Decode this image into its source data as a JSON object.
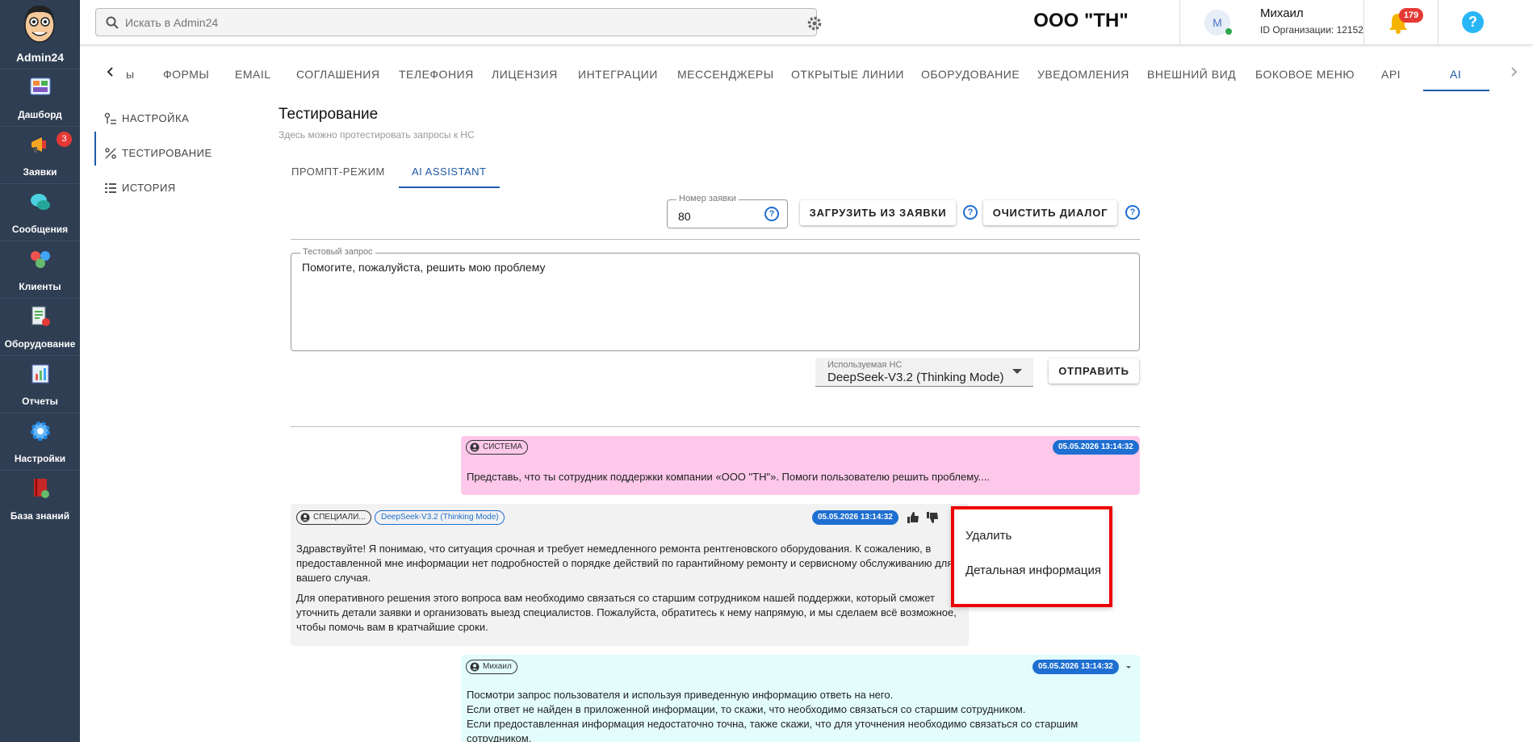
{
  "app": {
    "name": "Admin24"
  },
  "sidebar": {
    "items": [
      {
        "label": "Дашборд",
        "icon": "dashboard-icon"
      },
      {
        "label": "Заявки",
        "icon": "megaphone-icon",
        "badge": "3"
      },
      {
        "label": "Сообщения",
        "icon": "chat-icon"
      },
      {
        "label": "Клиенты",
        "icon": "clients-icon"
      },
      {
        "label": "Оборудование",
        "icon": "equipment-icon"
      },
      {
        "label": "Отчеты",
        "icon": "reports-icon"
      },
      {
        "label": "Настройки",
        "icon": "gear-icon"
      },
      {
        "label": "База знаний",
        "icon": "knowledge-base-icon"
      }
    ]
  },
  "header": {
    "search_placeholder": "Искать в Admin24",
    "org_title": "ООО \"ТН\"",
    "user": {
      "initial": "М",
      "name": "Михаил",
      "org_id": "ID Организации: 12152"
    },
    "notifications_count": "179",
    "help_label": "?"
  },
  "tabs": [
    "ы",
    "ФОРМЫ",
    "EMAIL",
    "СОГЛАШЕНИЯ",
    "ТЕЛЕФОНИЯ",
    "ЛИЦЕНЗИЯ",
    "ИНТЕГРАЦИИ",
    "МЕССЕНДЖЕРЫ",
    "ОТКРЫТЫЕ ЛИНИИ",
    "ОБОРУДОВАНИЕ",
    "УВЕДОМЛЕНИЯ",
    "ВНЕШНИЙ ВИД",
    "БОКОВОЕ МЕНЮ",
    "API",
    "AI"
  ],
  "submenu": [
    "НАСТРОЙКА",
    "ТЕСТИРОВАНИЕ",
    "ИСТОРИЯ"
  ],
  "page": {
    "title": "Тестирование",
    "subtitle": "Здесь можно протестировать запросы к НС",
    "inner_tabs": [
      "ПРОМПТ-РЕЖИМ",
      "AI ASSISTANT"
    ],
    "ticket_field": {
      "label": "Номер заявки",
      "value": "80"
    },
    "load_button": "ЗАГРУЗИТЬ ИЗ ЗАЯВКИ",
    "clear_button": "ОЧИСТИТЬ ДИАЛОГ",
    "query_field": {
      "label": "Тестовый запрос",
      "value": "Помогите, пожалуйста, решить мою проблему"
    },
    "model_select": {
      "label": "Используемая НС",
      "value": "DeepSeek-V3.2 (Thinking Mode)"
    },
    "send_button": "ОТПРАВИТЬ"
  },
  "messages": [
    {
      "role": "СИСТЕМА",
      "date": "05.05.2026 13:14:32",
      "text": "Представь, что ты сотрудник поддержки компании «ООО \"ТН\"». Помоги пользователю решить проблему...."
    },
    {
      "role": "СПЕЦИАЛИ...",
      "model": "DeepSeek-V3.2 (Thinking Mode)",
      "date": "05.05.2026 13:14:32",
      "paragraphs": [
        "Здравствуйте! Я понимаю, что ситуация срочная и требует немедленного ремонта рентгеновского оборудования. К сожалению, в предоставленной мне информации нет подробностей о порядке действий по гарантийному ремонту и сервисному обслуживанию для вашего случая.",
        "Для оперативного решения этого вопроса вам необходимо связаться со старшим сотрудником нашей поддержки, который сможет уточнить детали заявки и организовать выезд специалистов. Пожалуйста, обратитесь к нему напрямую, и мы сделаем всё возможное, чтобы помочь вам в кратчайшие сроки."
      ]
    },
    {
      "role": "Михаил",
      "date": "05.05.2026 13:14:32",
      "lines": [
        "Посмотри запрос пользователя и используя приведенную информацию ответь на него.",
        "Если ответ не найден в приложенной информации, то скажи, что необходимо связаться со старшим сотрудником.",
        "Если предоставленная информация недостаточно точна, также скажи, что для уточнения необходимо связаться со старшим",
        "сотрудником."
      ]
    }
  ],
  "context_menu": {
    "items": [
      "Удалить",
      "Детальная информация"
    ]
  },
  "colors": {
    "sidebar_bg": "#2f3e52",
    "accent": "#1e5aa8",
    "system_msg_bg": "#fdc8ea",
    "assistant_msg_bg": "#f2f2f2",
    "user_msg_bg": "#e3fdfd",
    "highlight_border": "#ee0000"
  }
}
